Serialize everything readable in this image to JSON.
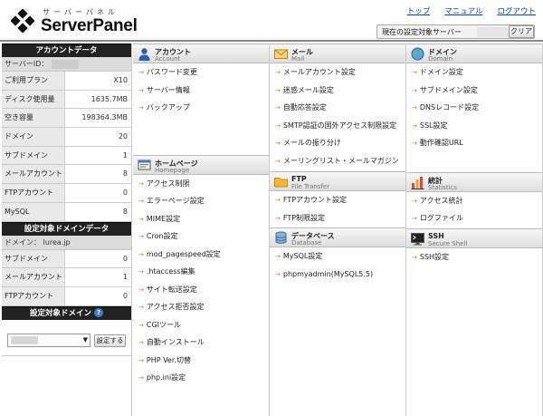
{
  "header": {
    "logo_sub": "サーバーパネル",
    "logo_main": "ServerPanel",
    "links": [
      "トップ",
      "マニュアル",
      "ログアウト"
    ],
    "server_label": "現在の設定対象サーバー",
    "clear_label": "クリア"
  },
  "sidebar": {
    "account_title": "アカウントデータ",
    "server_id_label": "サーバーID：",
    "account_rows": [
      {
        "k": "ご利用プラン",
        "v": "X10"
      },
      {
        "k": "ディスク使用量",
        "v": "1635.7MB"
      },
      {
        "k": "空き容量",
        "v": "198364.3MB"
      },
      {
        "k": "ドメイン",
        "v": "20"
      },
      {
        "k": "サブドメイン",
        "v": "1"
      },
      {
        "k": "メールアカウント",
        "v": "8"
      },
      {
        "k": "FTPアカウント",
        "v": "0"
      },
      {
        "k": "MySQL",
        "v": "8"
      }
    ],
    "domain_title": "設定対象ドメインデータ",
    "domain_label": "ドメイン： lurea.jp",
    "domain_rows": [
      {
        "k": "サブドメイン",
        "v": "0"
      },
      {
        "k": "メールアカウント",
        "v": "1"
      },
      {
        "k": "FTPアカウント",
        "v": "0"
      }
    ],
    "select_title": "設定対象ドメイン",
    "set_button": "設定する"
  },
  "sections": {
    "account": {
      "title": "アカウント",
      "sub": "Account",
      "items": [
        "パスワード変更",
        "サーバー情報",
        "バックアップ"
      ]
    },
    "homepage": {
      "title": "ホームページ",
      "sub": "Homepage",
      "items": [
        "アクセス制限",
        "エラーページ設定",
        "MIME設定",
        "Cron設定",
        "mod_pagespeed設定",
        ".htaccess編集",
        "サイト転送設定",
        "アクセス拒否設定",
        "CGIツール",
        "自動インストール",
        "PHP Ver.切替",
        "php.ini設定"
      ]
    },
    "mail": {
      "title": "メール",
      "sub": "Mail",
      "items": [
        "メールアカウント設定",
        "迷惑メール設定",
        "自動応答設定",
        "SMTP認証の国外アクセス制限設定",
        "メールの振り分け",
        "メーリングリスト・メールマガジン"
      ]
    },
    "ftp": {
      "title": "FTP",
      "sub": "File Transfer",
      "items": [
        "FTPアカウント設定",
        "FTP制限設定"
      ]
    },
    "database": {
      "title": "データベース",
      "sub": "Database",
      "items": [
        "MySQL設定",
        "phpmyadmin(MySQL5.5)"
      ]
    },
    "domain": {
      "title": "ドメイン",
      "sub": "Domain",
      "items": [
        "ドメイン設定",
        "サブドメイン設定",
        "DNSレコード設定",
        "SSL設定",
        "動作確認URL"
      ]
    },
    "stats": {
      "title": "統計",
      "sub": "Statistics",
      "items": [
        "アクセス統計",
        "ログファイル"
      ]
    },
    "ssh": {
      "title": "SSH",
      "sub": "Secure Shell",
      "items": [
        "SSH設定"
      ]
    }
  }
}
